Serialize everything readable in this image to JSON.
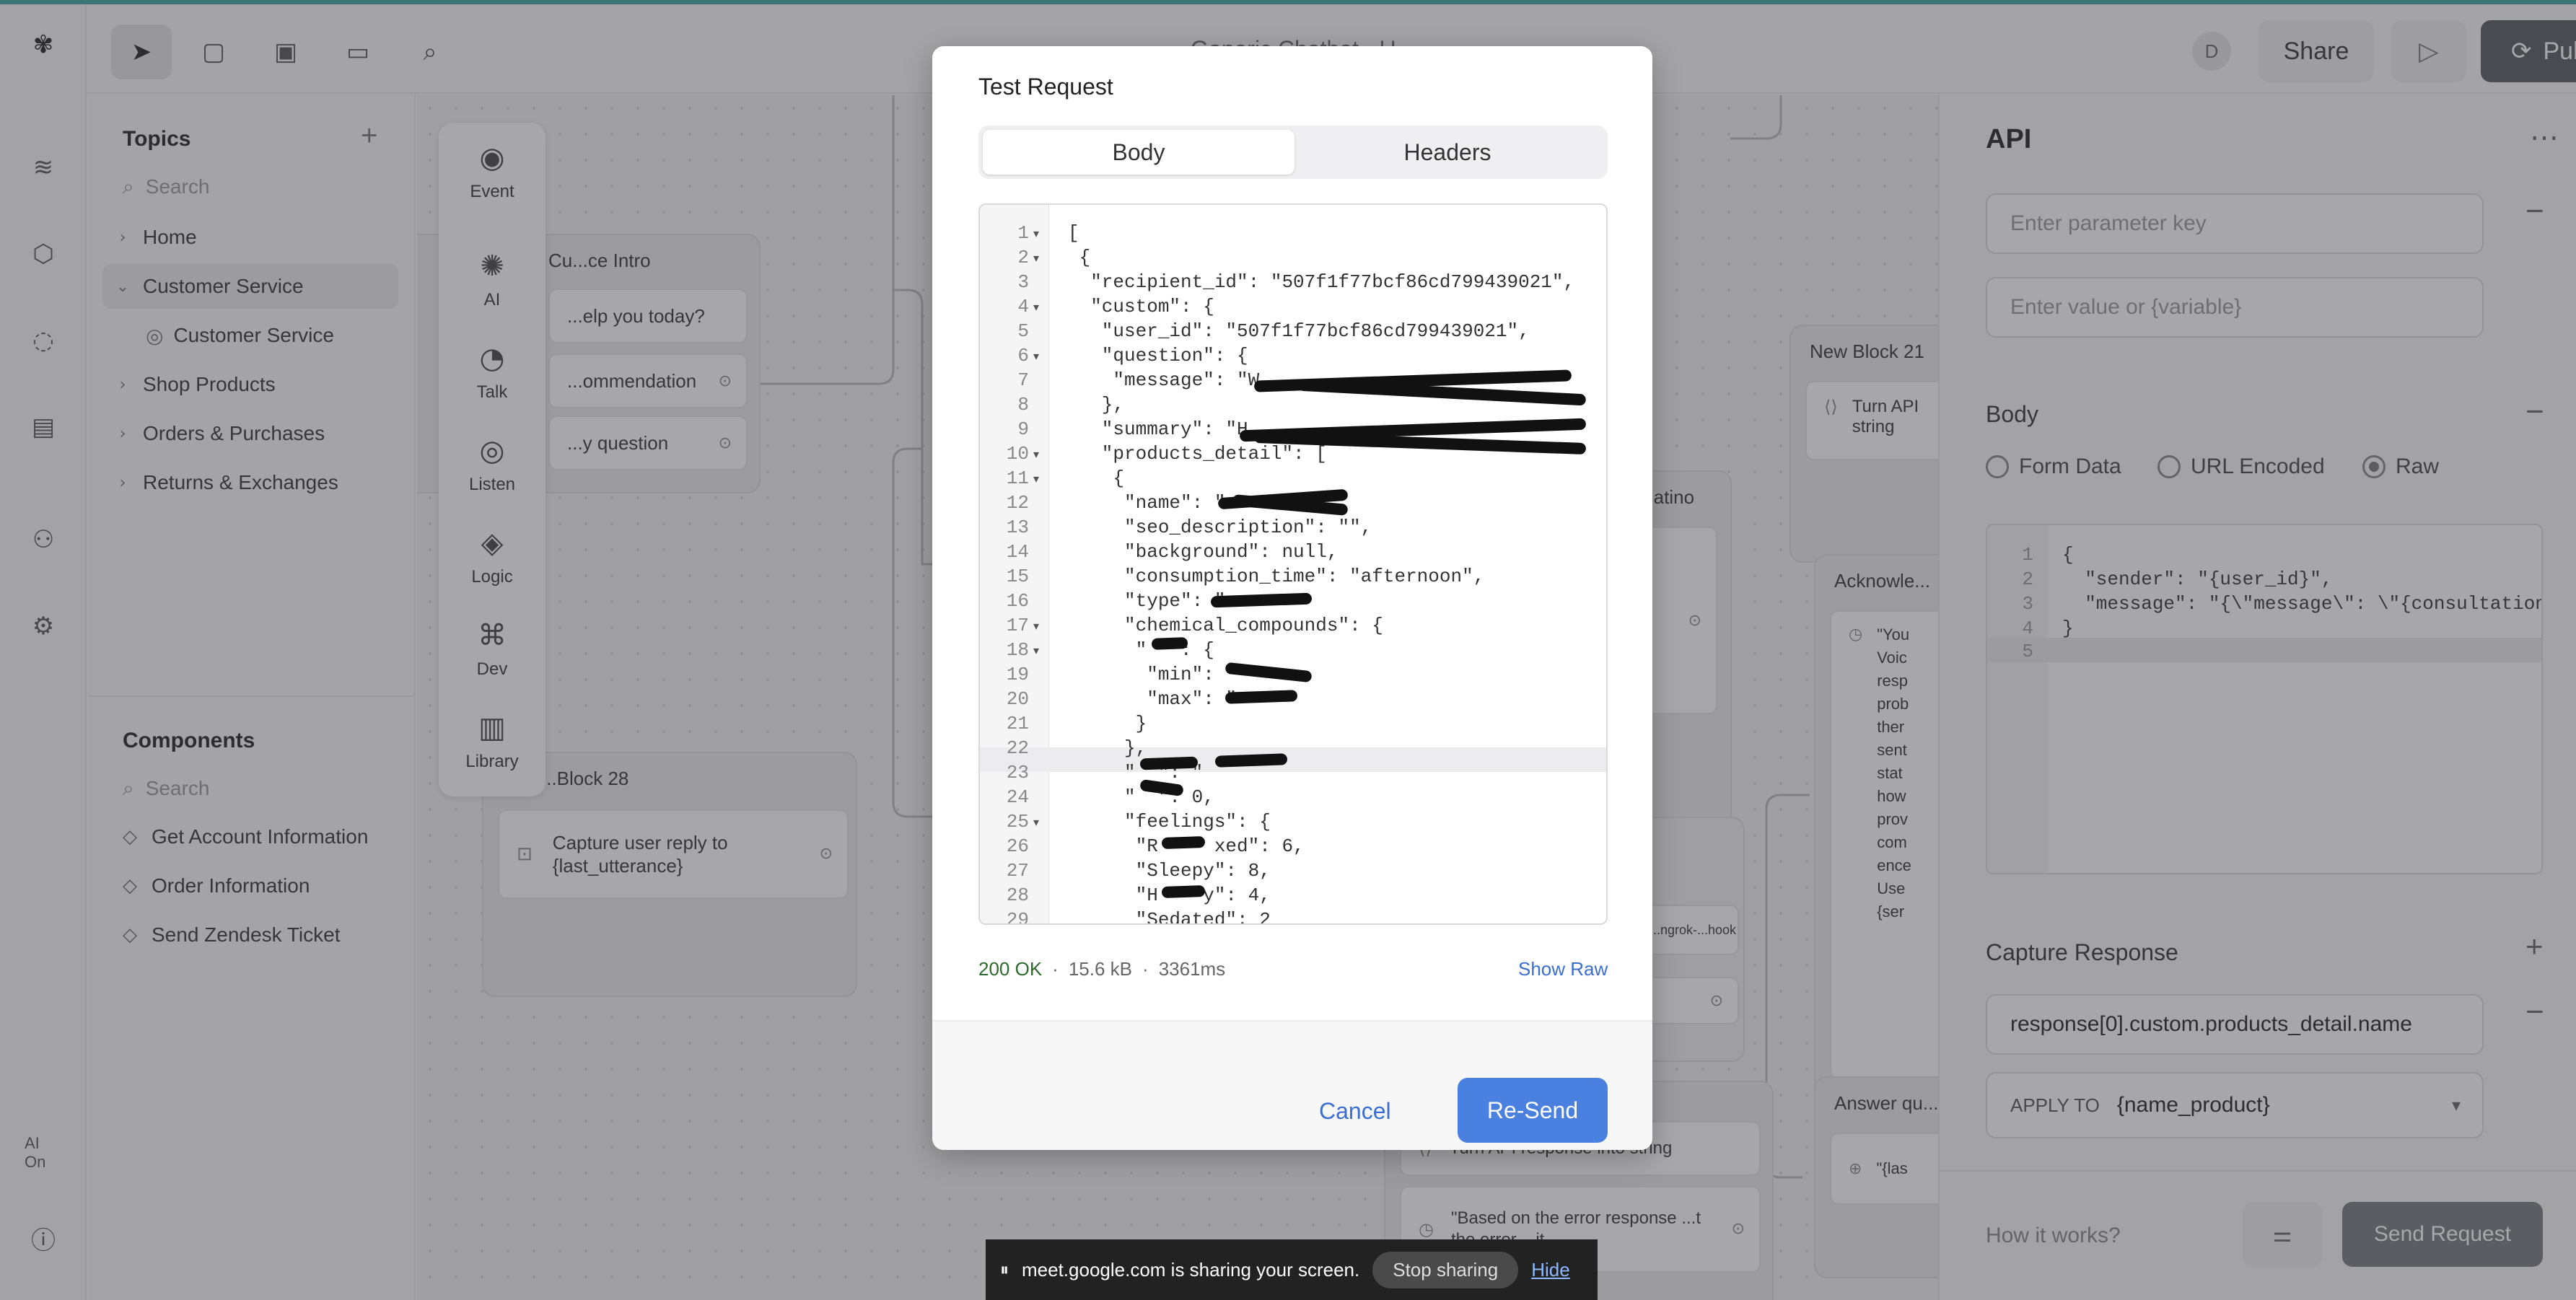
{
  "top": {
    "doc_title": "Generic Chatbot - U...",
    "avatar_initial": "D",
    "share_label": "Share",
    "publish_label": "Publish",
    "tools": [
      "cursor-icon",
      "note-icon",
      "image-icon",
      "comment-icon",
      "search-icon"
    ]
  },
  "rail": {
    "icons": [
      "layers-icon",
      "cube-icon",
      "chat-icon",
      "chart-icon",
      "flow-icon",
      "gear-icon"
    ],
    "ai_badge": "AI On",
    "info_icon": "info-icon"
  },
  "topics": {
    "title": "Topics",
    "search_placeholder": "Search",
    "items": [
      {
        "label": "Home",
        "level": 0,
        "expanded": false
      },
      {
        "label": "Customer Service",
        "level": 0,
        "expanded": true,
        "selected": true
      },
      {
        "label": "Customer Service",
        "level": 1
      },
      {
        "label": "Shop Products",
        "level": 0,
        "expanded": false
      },
      {
        "label": "Orders & Purchases",
        "level": 0,
        "expanded": false
      },
      {
        "label": "Returns & Exchanges",
        "level": 0,
        "expanded": false
      }
    ]
  },
  "components": {
    "title": "Components",
    "search_placeholder": "Search",
    "items": [
      "Get Account Information",
      "Order Information",
      "Send Zendesk Ticket"
    ]
  },
  "toolbox": {
    "items": [
      "Event",
      "AI",
      "Talk",
      "Listen",
      "Logic",
      "Dev",
      "Library"
    ]
  },
  "canvas": {
    "cards": [
      {
        "title": "Cu...ce Intro",
        "steps": [
          "...elp you today?",
          "...ommendation",
          "...y question"
        ]
      },
      {
        "title": "...Block 28",
        "steps": [
          "Capture user reply to {last_utterance}"
        ]
      },
      {
        "title": "New Block 21",
        "steps": [
          "Turn API string"
        ]
      },
      {
        "title": "...atino",
        "steps": []
      },
      {
        "title": "Acknowle...",
        "steps": [
          "\"You Voic resp prob ther sent stat how prov com ence Use {ser"
        ]
      },
      {
        "title": "Answer qu...",
        "steps": [
          "\"{las"
        ]
      },
      {
        "title": "",
        "steps": [
          "Turn API response into string",
          "\"Based on the error response ...t the error ...it."
        ]
      },
      {
        "title": "",
        "steps": [
          "...ngrok-...hook"
        ]
      }
    ]
  },
  "right_panel": {
    "title": "API",
    "param_key_placeholder": "Enter parameter key",
    "param_value_placeholder": "Enter value or {variable}",
    "body_title": "Body",
    "body_types": [
      "Form Data",
      "URL Encoded",
      "Raw"
    ],
    "body_selected": "Raw",
    "body_code": [
      "{",
      "  \"sender\": \"{user_id}\",",
      "  \"message\": \"{\\\"message\\\": \\\"{consultation",
      "}",
      ""
    ],
    "capture_title": "Capture Response",
    "capture_path": "response[0].custom.products_detail.name",
    "apply_label": "APPLY TO",
    "apply_value": "{name_product}",
    "how_it_works": "How it works?",
    "send_label": "Send Request"
  },
  "modal": {
    "title": "Test Request",
    "tabs": [
      "Body",
      "Headers"
    ],
    "active_tab": "Body",
    "code_lines": [
      "[",
      " {",
      "  \"recipient_id\": \"507f1f77bcf86cd799439021\",",
      "  \"custom\": {",
      "   \"user_id\": \"507f1f77bcf86cd799439021\",",
      "   \"question\": {",
      "    \"message\": \"W",
      "   },",
      "   \"summary\": \"H",
      "   \"products_detail\": [",
      "    {",
      "     \"name\": \"",
      "     \"seo_description\": \"\",",
      "     \"background\": null,",
      "     \"consumption_time\": \"afternoon\",",
      "     \"type\": \"",
      "     \"chemical_compounds\": {",
      "      \"  \": {",
      "       \"min\": \"",
      "       \"max\": \"",
      "      }",
      "     },",
      "     \"  \": \"",
      "     \"  \": 0,",
      "     \"feelings\": {",
      "      \"R     xed\": 6,",
      "      \"Sleepy\": 8,",
      "      \"H    y\": 4,",
      "      \"Sedated\": 2"
    ],
    "status_code": "200 OK",
    "size": "15.6 kB",
    "time": "3361ms",
    "show_raw": "Show Raw",
    "cancel": "Cancel",
    "resend": "Re-Send"
  },
  "share_bar": {
    "text": "meet.google.com is sharing your screen.",
    "stop": "Stop sharing",
    "hide": "Hide"
  }
}
